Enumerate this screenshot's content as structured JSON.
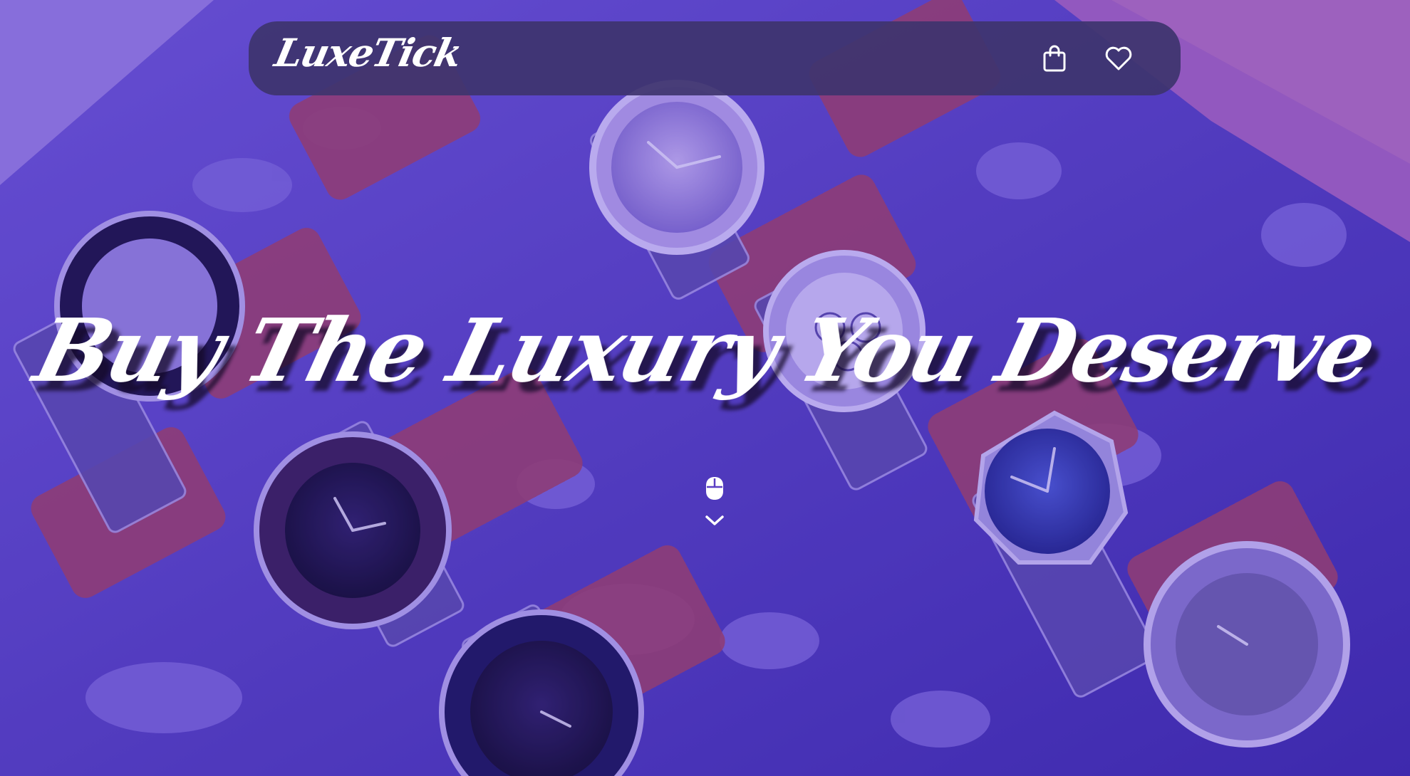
{
  "navbar": {
    "logo_text": "LuxeTick",
    "icons": [
      "shopping-bag-icon",
      "heart-icon"
    ]
  },
  "hero": {
    "headline": "Buy The Luxury You Deserve",
    "scroll_icons": [
      "mouse-icon",
      "chevron-down-icon"
    ]
  },
  "colors": {
    "navbar_bg": "#3e346e",
    "overlay_tint": "#6e50dc",
    "text": "#ffffff"
  }
}
